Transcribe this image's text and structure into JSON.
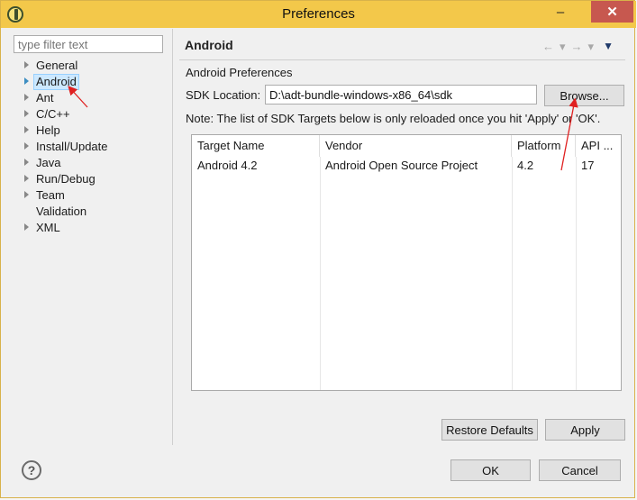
{
  "window": {
    "title": "Preferences",
    "minimize": "–",
    "close": "✕"
  },
  "filter": {
    "placeholder": "type filter text"
  },
  "tree": {
    "items": [
      {
        "label": "General"
      },
      {
        "label": "Android"
      },
      {
        "label": "Ant"
      },
      {
        "label": "C/C++"
      },
      {
        "label": "Help"
      },
      {
        "label": "Install/Update"
      },
      {
        "label": "Java"
      },
      {
        "label": "Run/Debug"
      },
      {
        "label": "Team"
      },
      {
        "label": "Validation"
      },
      {
        "label": "XML"
      }
    ]
  },
  "page": {
    "title": "Android",
    "preferences_label": "Android Preferences",
    "sdk_label": "SDK Location:",
    "sdk_value": "D:\\adt-bundle-windows-x86_64\\sdk",
    "browse": "Browse...",
    "note": "Note: The list of SDK Targets below is only reloaded once you hit 'Apply' or 'OK'.",
    "table": {
      "headers": [
        "Target Name",
        "Vendor",
        "Platform",
        "API ..."
      ],
      "rows": [
        [
          "Android 4.2",
          "Android Open Source Project",
          "4.2",
          "17"
        ]
      ]
    },
    "restore_defaults": "Restore Defaults",
    "apply": "Apply"
  },
  "footer": {
    "help": "?",
    "ok": "OK",
    "cancel": "Cancel"
  },
  "nav": {
    "back_icon": "←",
    "forward_icon": "→",
    "dropdown": "▾",
    "menu": "▼"
  },
  "colors": {
    "titlebar": "#f3c84a",
    "selection": "#cce8ff",
    "annotation": "#e02020"
  }
}
